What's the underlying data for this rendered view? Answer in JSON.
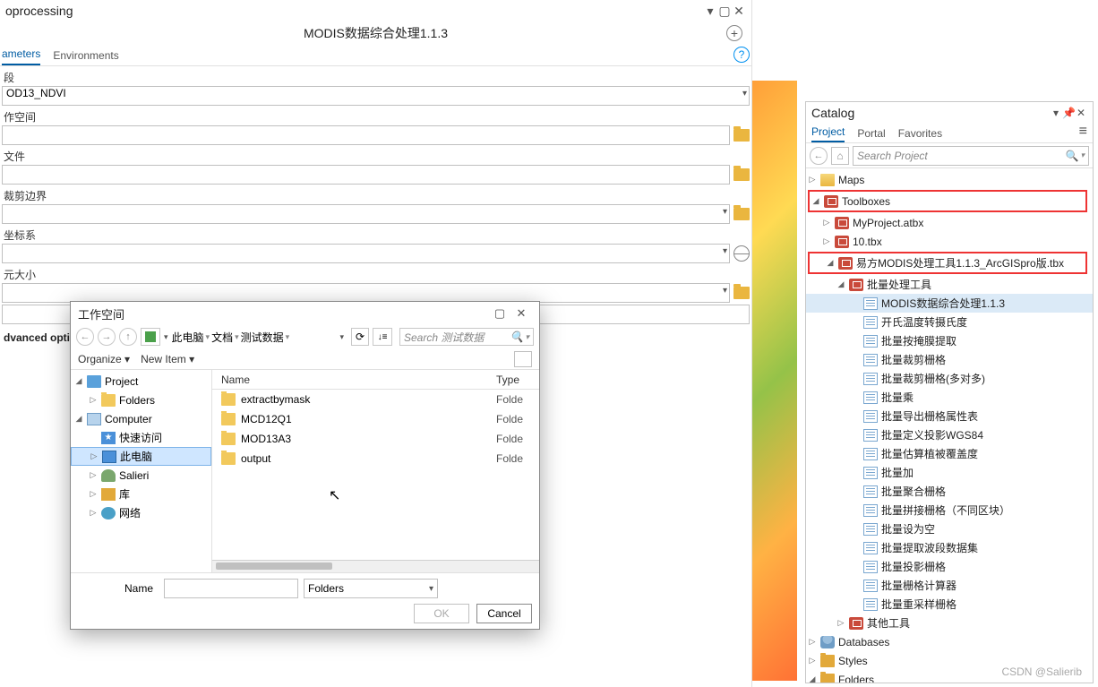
{
  "gp": {
    "title": "oprocessing",
    "tool_name": "MODIS数据综合处理1.1.3",
    "tabs": {
      "parameters": "ameters",
      "environments": "Environments"
    },
    "params": {
      "field": {
        "label": "段",
        "value": "OD13_NDVI"
      },
      "workspace": {
        "label": "作空间"
      },
      "file": {
        "label": "文件"
      },
      "clip": {
        "label": "裁剪边界"
      },
      "crs": {
        "label": "坐标系"
      },
      "cellsize": {
        "label": "元大小"
      }
    },
    "adv": "dvanced options"
  },
  "dlg": {
    "title": "工作空间",
    "breadcrumb": [
      "此电脑",
      "文档",
      "测试数据"
    ],
    "search_placeholder": "Search 测试数据",
    "organize": "Organize",
    "newitem": "New Item",
    "cols": {
      "name": "Name",
      "type": "Type"
    },
    "tree": [
      {
        "lvl": 0,
        "tw": "◢",
        "icon": "proj",
        "label": "Project"
      },
      {
        "lvl": 1,
        "tw": "▷",
        "icon": "foldy",
        "label": "Folders"
      },
      {
        "lvl": 0,
        "tw": "◢",
        "icon": "comp",
        "label": "Computer"
      },
      {
        "lvl": 1,
        "tw": "",
        "icon": "star",
        "label": "快速访问"
      },
      {
        "lvl": 1,
        "tw": "▷",
        "icon": "mon",
        "label": "此电脑",
        "sel": true
      },
      {
        "lvl": 1,
        "tw": "▷",
        "icon": "user",
        "label": "Salieri"
      },
      {
        "lvl": 1,
        "tw": "▷",
        "icon": "lib",
        "label": "库"
      },
      {
        "lvl": 1,
        "tw": "▷",
        "icon": "net",
        "label": "网络"
      }
    ],
    "rows": [
      {
        "name": "extractbymask",
        "type": "Folde"
      },
      {
        "name": "MCD12Q1",
        "type": "Folde"
      },
      {
        "name": "MOD13A3",
        "type": "Folde"
      },
      {
        "name": "output",
        "type": "Folde"
      }
    ],
    "name_label": "Name",
    "filter": "Folders",
    "ok": "OK",
    "cancel": "Cancel"
  },
  "catalog": {
    "title": "Catalog",
    "tabs": {
      "project": "Project",
      "portal": "Portal",
      "favorites": "Favorites"
    },
    "search_placeholder": "Search Project",
    "tree": [
      {
        "lvl": 0,
        "tw": "▷",
        "icon": "map",
        "label": "Maps"
      },
      {
        "lvl": 0,
        "tw": "◢",
        "icon": "tbx",
        "label": "Toolboxes",
        "red": true
      },
      {
        "lvl": 1,
        "tw": "▷",
        "icon": "tbx",
        "label": "MyProject.atbx"
      },
      {
        "lvl": 1,
        "tw": "▷",
        "icon": "tbx",
        "label": "10.tbx"
      },
      {
        "lvl": 1,
        "tw": "◢",
        "icon": "tbx",
        "label": "易方MODIS处理工具1.1.3_ArcGISpro版.tbx",
        "red": true
      },
      {
        "lvl": 2,
        "tw": "◢",
        "icon": "tbx",
        "label": "批量处理工具"
      },
      {
        "lvl": 3,
        "tw": "",
        "icon": "script",
        "label": "MODIS数据综合处理1.1.3",
        "sel": true
      },
      {
        "lvl": 3,
        "tw": "",
        "icon": "script",
        "label": "开氏温度转摄氏度"
      },
      {
        "lvl": 3,
        "tw": "",
        "icon": "script",
        "label": "批量按掩膜提取"
      },
      {
        "lvl": 3,
        "tw": "",
        "icon": "script",
        "label": "批量裁剪栅格"
      },
      {
        "lvl": 3,
        "tw": "",
        "icon": "script",
        "label": "批量裁剪栅格(多对多)"
      },
      {
        "lvl": 3,
        "tw": "",
        "icon": "script",
        "label": "批量乘"
      },
      {
        "lvl": 3,
        "tw": "",
        "icon": "script",
        "label": "批量导出栅格属性表"
      },
      {
        "lvl": 3,
        "tw": "",
        "icon": "script",
        "label": "批量定义投影WGS84"
      },
      {
        "lvl": 3,
        "tw": "",
        "icon": "script",
        "label": "批量估算植被覆盖度"
      },
      {
        "lvl": 3,
        "tw": "",
        "icon": "script",
        "label": "批量加"
      },
      {
        "lvl": 3,
        "tw": "",
        "icon": "script",
        "label": "批量聚合栅格"
      },
      {
        "lvl": 3,
        "tw": "",
        "icon": "script",
        "label": "批量拼接栅格（不同区块）"
      },
      {
        "lvl": 3,
        "tw": "",
        "icon": "script",
        "label": "批量设为空"
      },
      {
        "lvl": 3,
        "tw": "",
        "icon": "script",
        "label": "批量提取波段数据集"
      },
      {
        "lvl": 3,
        "tw": "",
        "icon": "script",
        "label": "批量投影栅格"
      },
      {
        "lvl": 3,
        "tw": "",
        "icon": "script",
        "label": "批量栅格计算器"
      },
      {
        "lvl": 3,
        "tw": "",
        "icon": "script",
        "label": "批量重采样栅格"
      },
      {
        "lvl": 2,
        "tw": "▷",
        "icon": "tbx",
        "label": "其他工具"
      },
      {
        "lvl": 0,
        "tw": "▷",
        "icon": "db",
        "label": "Databases"
      },
      {
        "lvl": 0,
        "tw": "▷",
        "icon": "folder",
        "label": "Styles"
      },
      {
        "lvl": 0,
        "tw": "◢",
        "icon": "folder",
        "label": "Folders"
      }
    ]
  },
  "watermark": "CSDN @Salierib"
}
